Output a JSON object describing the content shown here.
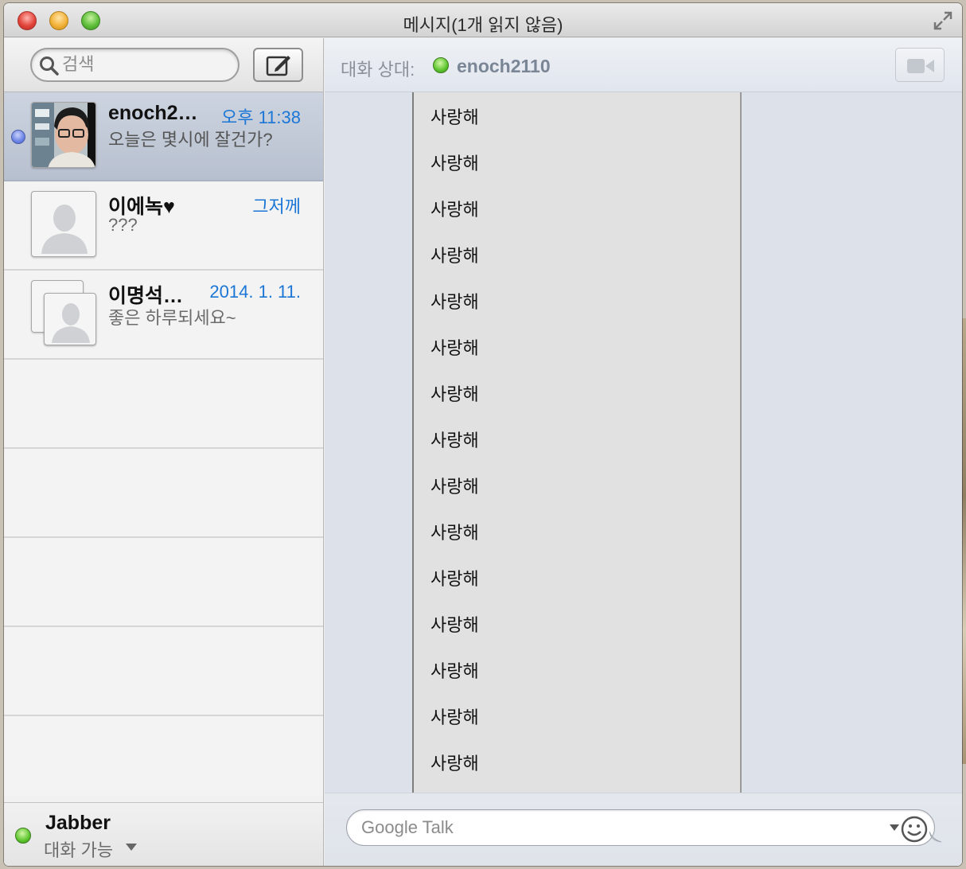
{
  "window": {
    "title": "메시지(1개 읽지 않음)"
  },
  "sidebar": {
    "search_placeholder": "검색",
    "conversations": [
      {
        "name": "enoch2…",
        "time": "오후 11:38",
        "preview": "오늘은 몇시에 잘건가?",
        "unread": true,
        "selected": true,
        "avatar": "photo"
      },
      {
        "name": "이에녹♥",
        "time": "그저께",
        "preview": "???",
        "unread": false,
        "selected": false,
        "avatar": "silhouette"
      },
      {
        "name": "이명석…",
        "time": "2014. 1. 11.",
        "preview": "좋은 하루되세요~",
        "unread": false,
        "selected": false,
        "avatar": "group-silhouette"
      }
    ],
    "account": {
      "name": "Jabber",
      "status": "대화 가능"
    }
  },
  "chat": {
    "to_label": "대화 상대:",
    "contact": "enoch2110",
    "messages": [
      "사랑해",
      "사랑해",
      "사랑해",
      "사랑해",
      "사랑해",
      "사랑해",
      "사랑해",
      "사랑해",
      "사랑해",
      "사랑해",
      "사랑해",
      "사랑해",
      "사랑해",
      "사랑해",
      "사랑해"
    ],
    "input_placeholder": "Google Talk"
  },
  "colors": {
    "unread_dot": "#6a82e4",
    "online": "#5bc42d",
    "timestamp": "#1b76d6"
  },
  "icons": [
    "search-icon",
    "compose-icon",
    "fullscreen-icon",
    "video-camera-icon",
    "emoji-icon",
    "chevron-down-icon"
  ]
}
